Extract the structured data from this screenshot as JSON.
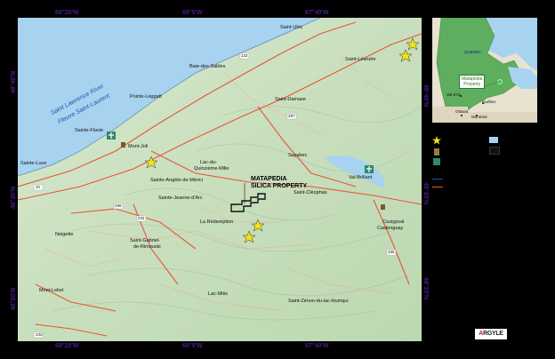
{
  "map": {
    "coords_top": [
      "68°20'W",
      "68°0'W",
      "67°40'W"
    ],
    "coords_bottom": [
      "68°20'W",
      "68°0'W",
      "67°40'W"
    ],
    "coords_left": [
      "48°40'N",
      "48°30'N",
      "48°20'N"
    ],
    "coords_right": [
      "48°40'N",
      "48°30'N",
      "48°20'N"
    ],
    "river_en": "Saint Lawrence River",
    "river_fr": "Fleuve Saint-Laurent",
    "property_title_line1": "MATAPEDIA",
    "property_title_line2": "SILICA PROPERTY",
    "towns": {
      "saint_ulric": "Saint-Ulric",
      "saint_leandre": "Saint-Léandre",
      "baie_des_sables": "Baie-des-Sables",
      "pointe_leggatt": "Pointe-Leggatt",
      "saint_damase": "Saint-Damase",
      "sainte_flavie": "Sainte-Flavie",
      "mont_joli": "Mont-Joli",
      "sainte_luce": "Sainte-Luce",
      "lac_du_quinzieme_mille_1": "Lac-du-",
      "lac_du_quinzieme_mille_2": "Quinzième-Mille",
      "sayabec": "Sayabec",
      "sainte_angele": "Sainte-Angèle-de-Mérici",
      "val_brillant": "Val-Brillant",
      "sainte_jeanne": "Sainte-Jeanne-d'Arc",
      "saint_cleophas": "Saint-Cléophas",
      "la_redemption": "La Rédemption",
      "neigette": "Neigette",
      "saint_gabriel_1": "Saint-Gabriel-",
      "saint_gabriel_2": "de-Rimouski",
      "causapscal_1": "Coutурval",
      "causapscal_2": "Castonguay",
      "mont_lebel": "Mont-Lebel",
      "lac_mitis": "Lac-Mitis",
      "saint_zenon": "Saint-Zénon-du-lac-Humqui"
    },
    "routes": [
      "132",
      "297",
      "20",
      "298",
      "234",
      "195",
      "232"
    ]
  },
  "inset": {
    "quebec": "QUEBEC",
    "callout_line1": "Matapedia",
    "callout_line2": "Property",
    "val_dor": "Val-d'Or",
    "quebec_city": "Québec",
    "ottawa": "Ottawa",
    "montreal": "Montréal"
  },
  "logo": {
    "prefix": "A",
    "rest": "RGYLE"
  },
  "colors": {
    "land": "#cfe3c5",
    "water": "#a8d3f0",
    "road": "#e8553a",
    "star": "#f3e21a",
    "boundary": "#111111"
  }
}
